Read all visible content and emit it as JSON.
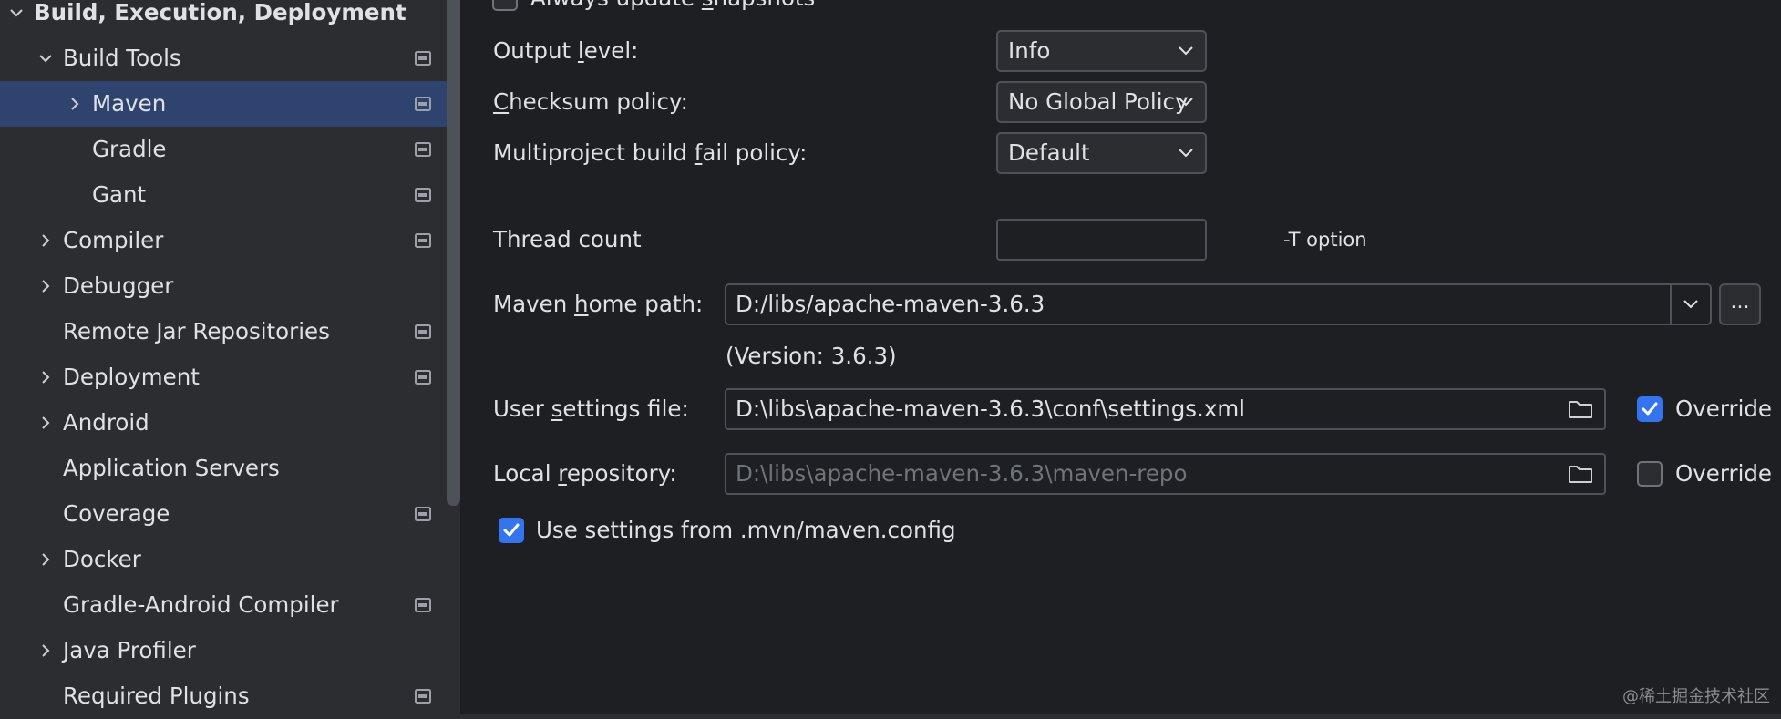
{
  "sidebar": {
    "items": [
      {
        "label": "Build, Execution, Deployment",
        "arrow": "down",
        "indent": 0,
        "bold": true,
        "proj": false,
        "selected": false
      },
      {
        "label": "Build Tools",
        "arrow": "down",
        "indent": 1,
        "bold": false,
        "proj": true,
        "selected": false
      },
      {
        "label": "Maven",
        "arrow": "right",
        "indent": 2,
        "bold": false,
        "proj": true,
        "selected": true
      },
      {
        "label": "Gradle",
        "arrow": "none",
        "indent": 2,
        "bold": false,
        "proj": true,
        "selected": false
      },
      {
        "label": "Gant",
        "arrow": "none",
        "indent": 2,
        "bold": false,
        "proj": true,
        "selected": false
      },
      {
        "label": "Compiler",
        "arrow": "right",
        "indent": 1,
        "bold": false,
        "proj": true,
        "selected": false
      },
      {
        "label": "Debugger",
        "arrow": "right",
        "indent": 1,
        "bold": false,
        "proj": false,
        "selected": false
      },
      {
        "label": "Remote Jar Repositories",
        "arrow": "none",
        "indent": 1,
        "bold": false,
        "proj": true,
        "selected": false
      },
      {
        "label": "Deployment",
        "arrow": "right",
        "indent": 1,
        "bold": false,
        "proj": true,
        "selected": false
      },
      {
        "label": "Android",
        "arrow": "right",
        "indent": 1,
        "bold": false,
        "proj": false,
        "selected": false
      },
      {
        "label": "Application Servers",
        "arrow": "none",
        "indent": 1,
        "bold": false,
        "proj": false,
        "selected": false
      },
      {
        "label": "Coverage",
        "arrow": "none",
        "indent": 1,
        "bold": false,
        "proj": true,
        "selected": false
      },
      {
        "label": "Docker",
        "arrow": "right",
        "indent": 1,
        "bold": false,
        "proj": false,
        "selected": false
      },
      {
        "label": "Gradle-Android Compiler",
        "arrow": "none",
        "indent": 1,
        "bold": false,
        "proj": true,
        "selected": false
      },
      {
        "label": "Java Profiler",
        "arrow": "right",
        "indent": 1,
        "bold": false,
        "proj": false,
        "selected": false
      },
      {
        "label": "Required Plugins",
        "arrow": "none",
        "indent": 1,
        "bold": false,
        "proj": true,
        "selected": false
      }
    ]
  },
  "main": {
    "always_update": {
      "pre": "Always update ",
      "mn": "s",
      "post": "napshots",
      "checked": false
    },
    "output_level": {
      "pre": "Output ",
      "mn": "l",
      "post": "evel:",
      "value": "Info"
    },
    "checksum_policy": {
      "pre": "",
      "mn": "C",
      "post": "hecksum policy:",
      "value": "No Global Policy"
    },
    "fail_policy": {
      "pre": "Multiproject build ",
      "mn": "f",
      "post": "ail policy:",
      "value": "Default"
    },
    "thread_count": {
      "label": "Thread count",
      "value": "",
      "hint": "-T option"
    },
    "maven_home": {
      "pre": "Maven ",
      "mn": "h",
      "post": "ome path:",
      "value": "D:/libs/apache-maven-3.6.3",
      "version": "(Version: 3.6.3)",
      "more": "..."
    },
    "user_settings": {
      "pre": "User ",
      "mn": "s",
      "post": "ettings file:",
      "value": "D:\\libs\\apache-maven-3.6.3\\conf\\settings.xml",
      "override_label": "Override",
      "override_checked": true
    },
    "local_repo": {
      "pre": "Local ",
      "mn": "r",
      "post": "epository:",
      "value": "D:\\libs\\apache-maven-3.6.3\\maven-repo",
      "override_label": "Override",
      "override_checked": false
    },
    "mvn_config": {
      "label": "Use settings from .mvn/maven.config",
      "checked": true
    }
  },
  "watermark": "@稀土掘金技术社区",
  "colors": {
    "selection": "#2e436e",
    "checkbox_on": "#3574f0",
    "panel_bg": "#1e1f22",
    "sidebar_bg": "#2b2d30"
  }
}
